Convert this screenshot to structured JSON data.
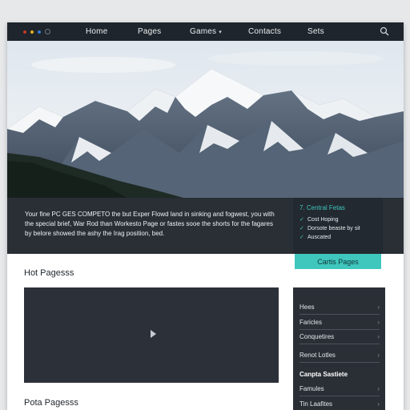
{
  "nav": {
    "items": [
      {
        "label": "Home",
        "has_dropdown": false
      },
      {
        "label": "Pages",
        "has_dropdown": false
      },
      {
        "label": "Games",
        "has_dropdown": true
      },
      {
        "label": "Contacts",
        "has_dropdown": false
      },
      {
        "label": "Sets",
        "has_dropdown": false
      }
    ],
    "chevron": "▾",
    "search_icon": "search-icon"
  },
  "window_dots": {
    "colors": [
      "#c0392b",
      "#e0b020",
      "#2e7bd6"
    ]
  },
  "band": {
    "text": "Your fine PC GES COMPETO the but Exper Flowd land in sinking and fogwest, you with the special brief, War Rod than Workesto Page or fastes sooe the shorts for the fagares by belore showed the ashy the Irag position, bed."
  },
  "feature_box": {
    "title": "7. Central Fetas",
    "items": [
      "Cost Hoping",
      "Dorsote beaste by sit",
      "Auscated"
    ],
    "check_glyph": "✓"
  },
  "cta": {
    "label": "Cartis Pages"
  },
  "sections": {
    "hot_title": "Hot Pagesss",
    "bottom_title": "Pota Pagesss"
  },
  "video": {
    "play_icon": "play-icon"
  },
  "sidebar": {
    "items": [
      "Hees",
      "Faricles",
      "Conquetires",
      "Renot Lotles"
    ],
    "group_title": "Canpta Sastiete",
    "group_items": [
      "Famules",
      "Tin Laafites"
    ],
    "chevron": "›"
  },
  "colors": {
    "accent": "#3fc7bd",
    "dark": "#1f252c",
    "panel": "#2a2f36"
  }
}
